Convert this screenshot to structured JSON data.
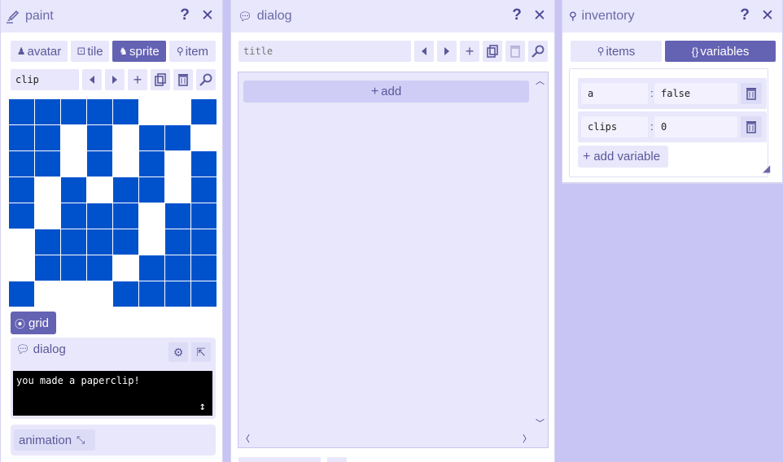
{
  "paint": {
    "title": "paint",
    "tabs": [
      {
        "label": "avatar",
        "icon": "avatar-icon"
      },
      {
        "label": "tile",
        "icon": "tile-icon"
      },
      {
        "label": "sprite",
        "icon": "sprite-icon",
        "active": true
      },
      {
        "label": "item",
        "icon": "item-icon"
      }
    ],
    "name_value": "clip",
    "grid": [
      [
        1,
        1,
        1,
        1,
        1,
        0,
        0,
        1
      ],
      [
        1,
        1,
        0,
        1,
        0,
        1,
        1,
        0
      ],
      [
        1,
        1,
        0,
        1,
        0,
        1,
        0,
        1
      ],
      [
        1,
        0,
        1,
        0,
        1,
        1,
        0,
        1
      ],
      [
        1,
        0,
        1,
        1,
        1,
        0,
        1,
        1
      ],
      [
        0,
        1,
        1,
        1,
        1,
        0,
        1,
        1
      ],
      [
        0,
        1,
        1,
        1,
        0,
        1,
        1,
        1
      ],
      [
        1,
        0,
        0,
        0,
        1,
        1,
        1,
        1
      ]
    ],
    "grid_toggle_label": "grid",
    "dialog_label": "dialog",
    "dialog_text": "you made a paperclip!",
    "animation_label": "animation"
  },
  "dialog": {
    "title": "dialog",
    "title_placeholder": "title",
    "add_label": "add"
  },
  "inventory": {
    "title": "inventory",
    "tabs": [
      {
        "label": "items",
        "icon": "item-icon"
      },
      {
        "label": "variables",
        "icon": "braces-icon",
        "active": true
      }
    ],
    "variables": [
      {
        "name": "a",
        "value": "false"
      },
      {
        "name": "clips",
        "value": "0"
      }
    ],
    "add_variable_label": "add variable"
  },
  "colors": {
    "accent": "#6462b3",
    "pixel_on": "#0052cc",
    "background": "#c8c5f5",
    "panel_header": "#e8e7fb"
  }
}
